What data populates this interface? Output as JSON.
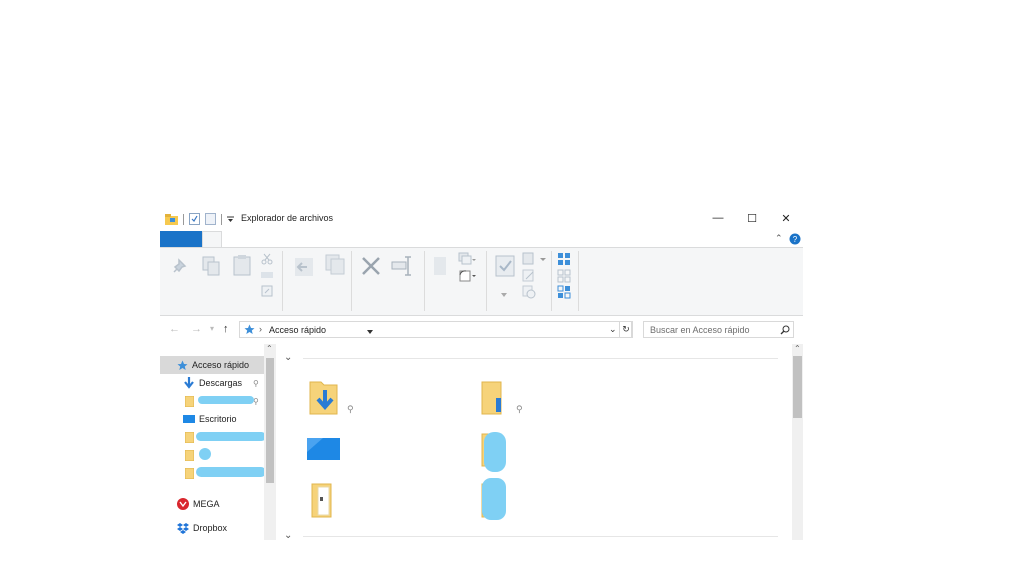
{
  "window": {
    "title": "Explorador de archivos",
    "controls": {
      "minimize": "—",
      "maximize": "☐",
      "close": "✕"
    }
  },
  "address": {
    "path": "Acceso rápido",
    "search_placeholder": "Buscar en Acceso rápido"
  },
  "navigation": {
    "items": [
      {
        "label": "Acceso rápido",
        "selected": true
      },
      {
        "label": "Descargas",
        "pinned": true
      },
      {
        "label": "",
        "pinned": true
      },
      {
        "label": "Escritorio"
      },
      {
        "label": ""
      },
      {
        "label": ""
      },
      {
        "label": ""
      },
      {
        "label": "MEGA"
      },
      {
        "label": "Dropbox"
      }
    ]
  },
  "colors": {
    "accent": "#1a73c8",
    "folder": "#f6d37a",
    "scribble": "#7fd0f4"
  },
  "icons": [
    "quick-access-star-icon",
    "downloads-arrow-icon",
    "folder-icon",
    "desktop-icon",
    "mega-icon",
    "dropbox-icon",
    "pin-icon"
  ]
}
